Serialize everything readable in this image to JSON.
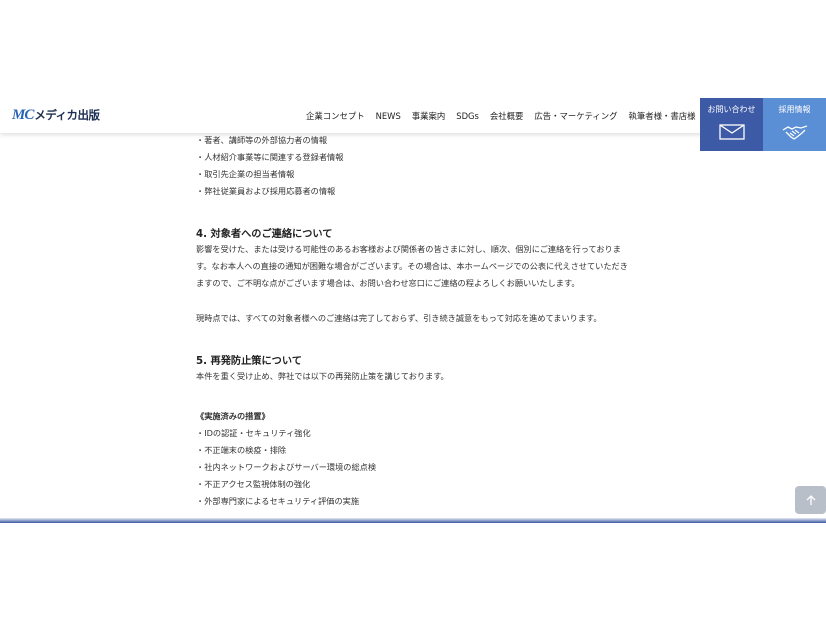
{
  "header": {
    "logo_mark": "MC",
    "logo_text": "メディカ出版",
    "nav": [
      "企業コンセプト",
      "NEWS",
      "事業案内",
      "SDGs",
      "会社概要",
      "広告・マーケティング",
      "執筆者様・書店様"
    ],
    "contact_label": "お問い合わせ",
    "recruit_label": "採用情報"
  },
  "content": {
    "list_top": [
      "・著者、講師等の外部協力者の情報",
      "・人材紹介事業等に関連する登録者情報",
      "・取引先企業の担当者情報",
      "・弊社従業員および採用応募者の情報"
    ],
    "section4_title": "4.  対象者へのご連絡について",
    "section4_body": "影響を受けた、または受ける可能性のあるお客様および関係者の皆さまに対し、順次、個別にご連絡を行っております。なお本人への直接の通知が困難な場合がございます。その場合は、本ホームページでの公表に代えさせていただきますので、ご不明な点がございます場合は、お問い合わせ窓口にご連絡の程よろしくお願いいたします。",
    "section4_note": "現時点では、すべての対象者様へのご連絡は完了しておらず、引き続き誠意をもって対応を進めてまいります。",
    "section5_title": "5.  再発防止策について",
    "section5_body": "本件を重く受け止め、弊社では以下の再発防止策を講じております。",
    "measures_title": "《実施済みの措置》",
    "measures": [
      "・IDの認証・セキュリティ強化",
      "・不正端末の検疫・排除",
      "・社内ネットワークおよびサーバー環境の総点検",
      "・不正アクセス監視体制の強化",
      "・外部専門家によるセキュリティ評価の実施"
    ]
  },
  "icons": {
    "contact": "envelope-icon",
    "recruit": "handshake-icon",
    "back_to_top": "arrow-up-icon"
  },
  "colors": {
    "contact_bg": "#3c5aa6",
    "recruit_bg": "#5b8fd5",
    "logo": "#2a62b8"
  }
}
